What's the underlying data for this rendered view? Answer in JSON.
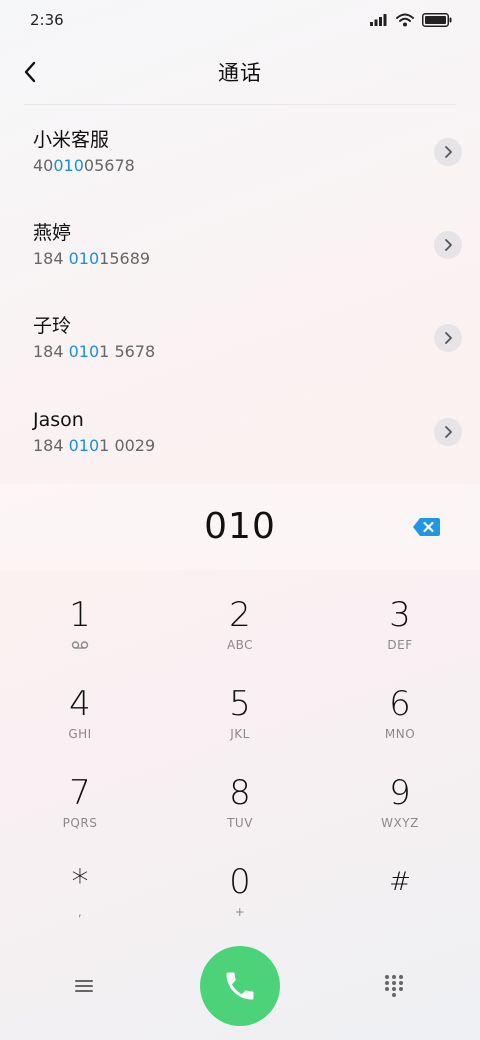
{
  "status_bar": {
    "time": "2:36",
    "icons": [
      "signal-icon",
      "wifi-icon",
      "battery-icon"
    ]
  },
  "header": {
    "title": "通话",
    "back_icon": "back-chevron-icon"
  },
  "contacts": [
    {
      "name": "小米客服",
      "number_pre": "40",
      "number_match": "010",
      "number_post": "05678"
    },
    {
      "name": "燕婷",
      "number_pre": "184 ",
      "number_match": "010",
      "number_post": "15689"
    },
    {
      "name": "子玲",
      "number_pre": "184 ",
      "number_match": "010",
      "number_post": "1 5678"
    },
    {
      "name": "Jason",
      "number_pre": "184 ",
      "number_match": "010",
      "number_post": "1 0029"
    }
  ],
  "dialer": {
    "entered_number": "010",
    "delete_icon": "backspace-icon"
  },
  "keypad": {
    "keys": [
      {
        "digit": "1",
        "letters": ""
      },
      {
        "digit": "2",
        "letters": "ABC"
      },
      {
        "digit": "3",
        "letters": "DEF"
      },
      {
        "digit": "4",
        "letters": "GHI"
      },
      {
        "digit": "5",
        "letters": "JKL"
      },
      {
        "digit": "6",
        "letters": "MNO"
      },
      {
        "digit": "7",
        "letters": "PQRS"
      },
      {
        "digit": "8",
        "letters": "TUV"
      },
      {
        "digit": "9",
        "letters": "WXYZ"
      },
      {
        "digit": "*",
        "letters": ","
      },
      {
        "digit": "0",
        "letters": "+"
      },
      {
        "digit": "#",
        "letters": ""
      }
    ]
  },
  "bottom_bar": {
    "menu_icon": "menu-icon",
    "call_icon": "phone-icon",
    "keypad_icon": "dialpad-icon"
  },
  "colors": {
    "accent": "#1a8fe0",
    "call_button": "#4cd37a"
  }
}
